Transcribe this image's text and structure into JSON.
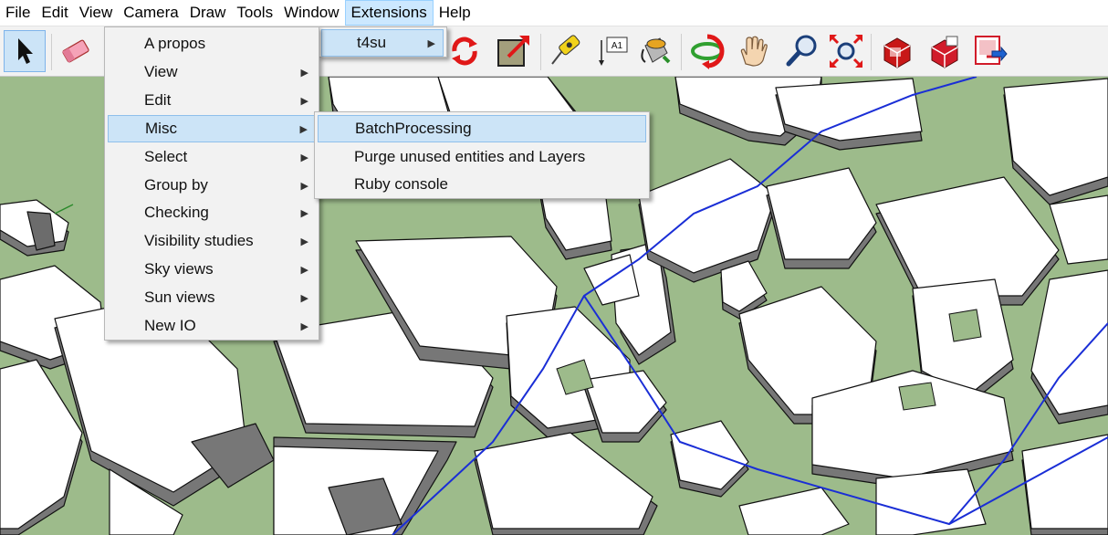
{
  "menubar": {
    "items": [
      "File",
      "Edit",
      "View",
      "Camera",
      "Draw",
      "Tools",
      "Window",
      "Extensions",
      "Help"
    ],
    "active": "Extensions"
  },
  "extensions_menu": {
    "items": [
      {
        "label": "t4su",
        "has_submenu": true
      }
    ]
  },
  "t4su_menu": {
    "items": [
      {
        "label": "A propos",
        "has_submenu": false
      },
      {
        "label": "View",
        "has_submenu": true
      },
      {
        "label": "Edit",
        "has_submenu": true
      },
      {
        "label": "Misc",
        "has_submenu": true,
        "highlighted": true
      },
      {
        "label": "Select",
        "has_submenu": true
      },
      {
        "label": "Group by",
        "has_submenu": true
      },
      {
        "label": "Checking",
        "has_submenu": true
      },
      {
        "label": "Visibility studies",
        "has_submenu": true
      },
      {
        "label": "Sky views",
        "has_submenu": true
      },
      {
        "label": "Sun views",
        "has_submenu": true
      },
      {
        "label": "New IO",
        "has_submenu": true
      }
    ]
  },
  "misc_menu": {
    "items": [
      {
        "label": "BatchProcessing",
        "highlighted": true
      },
      {
        "label": "Purge unused entities and Layers"
      },
      {
        "label": "Ruby console"
      }
    ]
  },
  "toolbar": {
    "tools": [
      "select-icon",
      "eraser-icon",
      "rotate-icon",
      "scale-icon",
      "tape-measure-icon",
      "text-icon",
      "paint-bucket-icon",
      "orbit-icon",
      "pan-icon",
      "zoom-icon",
      "zoom-extents-icon",
      "warehouse-icon",
      "extension-warehouse-icon",
      "send-to-layout-icon"
    ],
    "text_tool_label": "A1"
  },
  "colors": {
    "ground": "#9dbb8b",
    "building_top": "#ffffff",
    "building_side": "#7a7a7a",
    "edges": "#000000",
    "route": "#1a2ed6",
    "menu_highlight": "#cce4f7"
  }
}
